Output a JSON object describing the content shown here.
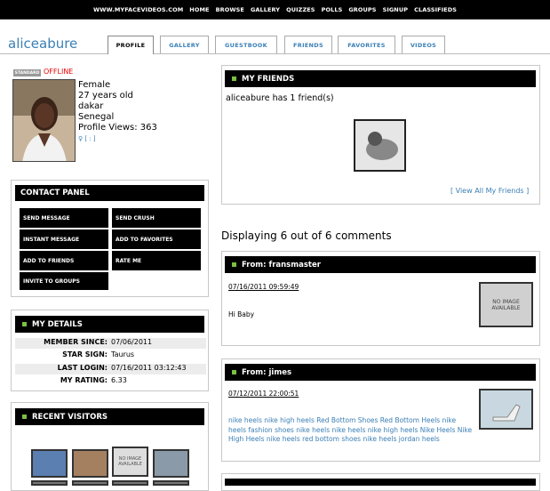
{
  "nav": {
    "items": [
      "WWW.MYFACEVIDEOS.COM",
      "HOME",
      "BROWSE",
      "GALLERY",
      "QUIZZES",
      "POLLS",
      "GROUPS",
      "SIGNUP",
      "CLASSIFIEDS"
    ]
  },
  "profile": {
    "username": "aliceabure",
    "status_badge": "STANDARD",
    "status": "OFFLINE",
    "gender": "Female",
    "age": "27 years old",
    "city": "dakar",
    "country": "Senegal",
    "views": "Profile Views: 363",
    "gender_icon_text": "[ : ]"
  },
  "tabs": [
    "PROFILE",
    "GALLERY",
    "GUESTBOOK",
    "FRIENDS",
    "FAVORITES",
    "VIDEOS"
  ],
  "contact": {
    "title": "CONTACT PANEL",
    "send_message": "SEND MESSAGE",
    "send_crush": "SEND CRUSH",
    "instant_message": "INSTANT MESSAGE",
    "add_favorites": "ADD TO FAVORITES",
    "add_friends": "ADD TO FRIENDS",
    "rate_me": "RATE ME",
    "invite_groups": "INVITE TO GROUPS"
  },
  "details": {
    "title": "MY DETAILS",
    "rows": [
      {
        "k": "MEMBER SINCE:",
        "v": "07/06/2011"
      },
      {
        "k": "STAR SIGN:",
        "v": "Taurus"
      },
      {
        "k": "LAST LOGIN:",
        "v": "07/16/2011 03:12:43"
      },
      {
        "k": "MY RATING:",
        "v": "6.33"
      }
    ]
  },
  "visitors": {
    "title": "RECENT VISITORS",
    "no_image": "NO IMAGE AVAILABLE"
  },
  "friends": {
    "title": "MY FRIENDS",
    "count_text": "aliceabure has 1 friend(s)",
    "view_all": "[ View All My Friends ]"
  },
  "comments": {
    "heading": "Displaying 6 out of 6 comments",
    "items": [
      {
        "from": "From: fransmaster",
        "date": "07/16/2011 09:59:49",
        "text": "Hi Baby",
        "img": "NO IMAGE AVAILABLE"
      },
      {
        "from": "From: jimes",
        "date": "07/12/2011 22:00:51",
        "text": "nike heels nike high heels Red Bottom Shoes Red Bottom Heels nike heels fashion shoes nike heels nike heels nike high heels Nike Heels Nike High Heels nike heels red bottom shoes nike heels jordan heels"
      }
    ]
  },
  "colors": {
    "accent": "#7bc043",
    "link": "#3b7fb5",
    "offline": "#ee0000"
  }
}
